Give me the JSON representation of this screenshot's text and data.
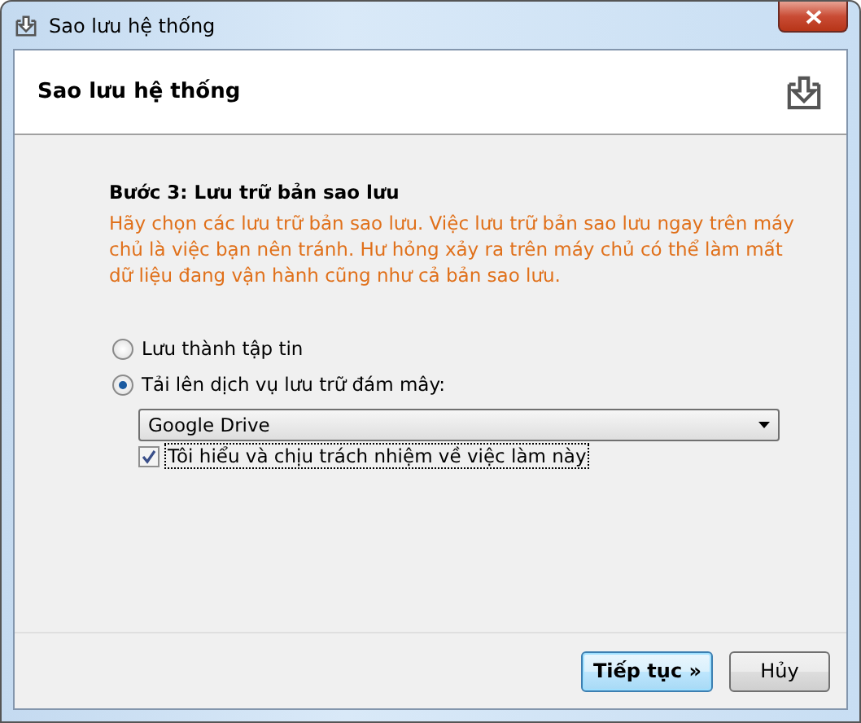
{
  "window": {
    "title": "Sao lưu hệ thống"
  },
  "header": {
    "title": "Sao lưu hệ thống"
  },
  "step": {
    "title": "Bước 3: Lưu trữ bản sao lưu",
    "description": "Hãy chọn các lưu trữ bản sao lưu. Việc lưu trữ bản sao lưu ngay trên máy chủ là việc bạn nên tránh. Hư hỏng xảy ra trên máy chủ có thể làm mất dữ liệu đang vận hành cũng như cả bản sao lưu."
  },
  "options": [
    {
      "label": "Lưu thành tập tin",
      "selected": false
    },
    {
      "label": "Tải lên dịch vụ lưu trữ đám mây:",
      "selected": true
    }
  ],
  "cloud_service": {
    "value": "Google Drive"
  },
  "consent": {
    "label": "Tôi hiểu và chịu trách nhiệm về việc làm này",
    "checked": true
  },
  "buttons": [
    {
      "label": "Tiếp tục »",
      "default": true
    },
    {
      "label": "Hủy",
      "default": false
    }
  ]
}
